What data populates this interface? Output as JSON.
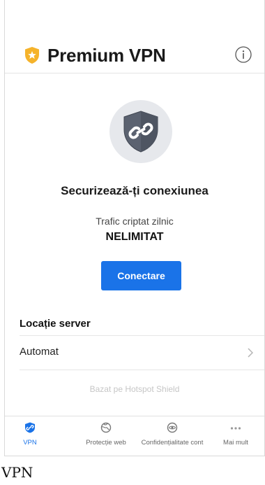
{
  "header": {
    "title": "Premium VPN",
    "brand_icon": "shield-star-icon",
    "info_icon": "info-icon",
    "accent": "#f5b32b"
  },
  "hero": {
    "icon": "shield-link-icon",
    "heading": "Securizează-ți conexiunea",
    "traffic_label": "Trafic criptat zilnic",
    "traffic_value": "NELIMITAT",
    "connect_label": "Conectare",
    "connect_color": "#1a73e8"
  },
  "location": {
    "title": "Locație server",
    "value": "Automat",
    "chevron_icon": "chevron-right-icon"
  },
  "powered_by": "Bazat pe Hotspot Shield",
  "tabs": [
    {
      "label": "VPN",
      "icon": "shield-link-icon",
      "active": true
    },
    {
      "label": "Protecție web",
      "icon": "globe-shield-icon",
      "active": false
    },
    {
      "label": "Confidențialitate cont",
      "icon": "eye-shield-icon",
      "active": false
    },
    {
      "label": "Mai mult",
      "icon": "more-dots-icon",
      "active": false
    }
  ],
  "caption": "VPN"
}
